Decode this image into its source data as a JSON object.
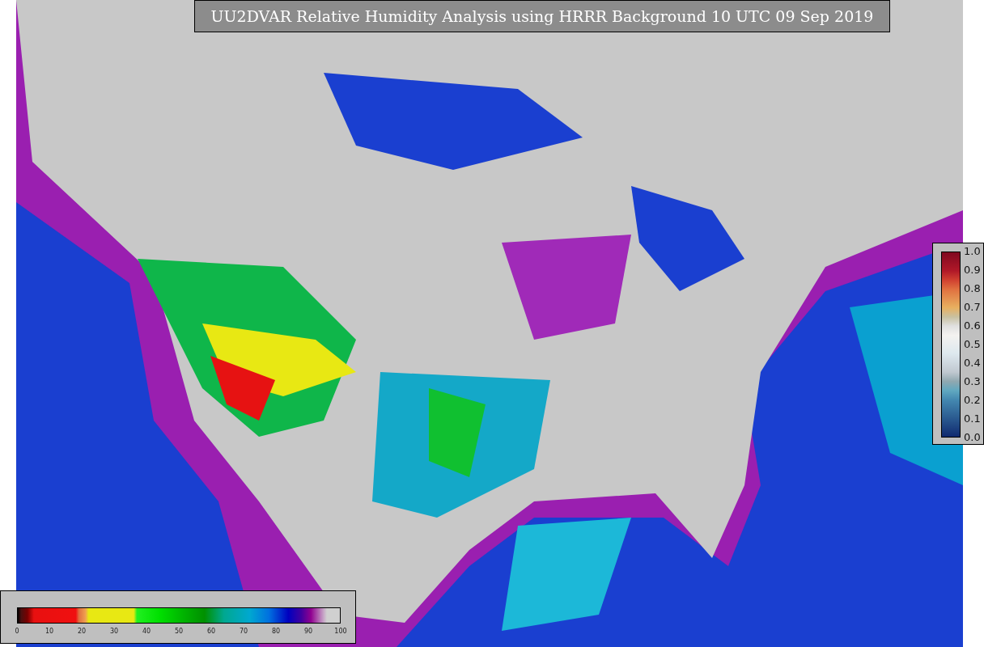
{
  "title": "UU2DVAR Relative Humidity Analysis using HRRR Background 10 UTC 09 Sep 2019",
  "humidity_scale": {
    "ticks": [
      "0",
      "10",
      "20",
      "30",
      "40",
      "50",
      "60",
      "70",
      "80",
      "90",
      "100"
    ]
  },
  "observation_scale": {
    "ticks": [
      "1.0",
      "0.9",
      "0.8",
      "0.7",
      "0.6",
      "0.5",
      "0.4",
      "0.3",
      "0.2",
      "0.1",
      "0.0"
    ]
  }
}
